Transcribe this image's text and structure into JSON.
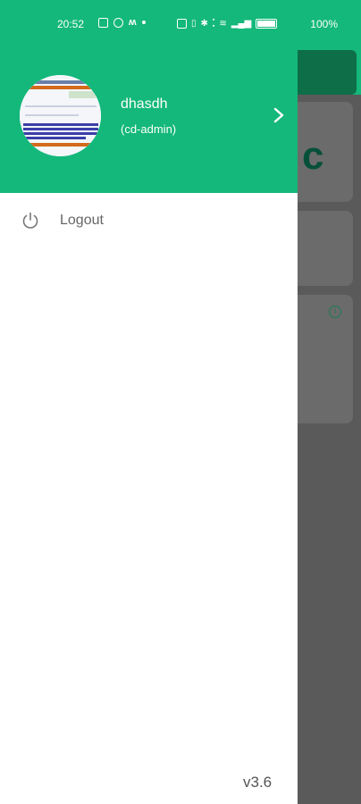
{
  "status_bar": {
    "time": "20:52",
    "battery": "100%"
  },
  "drawer": {
    "user": {
      "name": "dhasdh",
      "role": "(cd-admin)"
    },
    "menu": [
      {
        "label": "Logout",
        "icon": "power-icon"
      }
    ],
    "version": "v3.6"
  },
  "colors": {
    "primary": "#14b87a",
    "scrim": "#5e5e5e"
  }
}
